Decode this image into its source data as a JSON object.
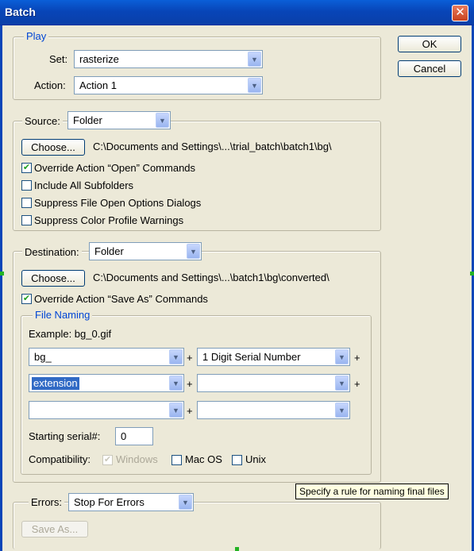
{
  "window": {
    "title": "Batch",
    "close_glyph": "✕"
  },
  "buttons": {
    "ok": "OK",
    "cancel": "Cancel"
  },
  "play": {
    "legend": "Play",
    "set_label": "Set:",
    "set_value": "rasterize",
    "action_label": "Action:",
    "action_value": "Action 1"
  },
  "source": {
    "label": "Source:",
    "value": "Folder",
    "choose_label": "Choose...",
    "path": "C:\\Documents and Settings\\...\\trial_batch\\batch1\\bg\\",
    "options": [
      {
        "label": "Override Action “Open” Commands",
        "checked": true
      },
      {
        "label": "Include All Subfolders",
        "checked": false
      },
      {
        "label": "Suppress File Open Options Dialogs",
        "checked": false
      },
      {
        "label": "Suppress Color Profile Warnings",
        "checked": false
      }
    ]
  },
  "destination": {
    "label": "Destination:",
    "value": "Folder",
    "choose_label": "Choose...",
    "path": "C:\\Documents and Settings\\...\\batch1\\bg\\converted\\",
    "override_label": "Override Action “Save As” Commands",
    "override_checked": true
  },
  "file_naming": {
    "legend": "File Naming",
    "example": "Example: bg_0.gif",
    "fields": [
      [
        "bg_",
        "1 Digit Serial Number"
      ],
      [
        "extension",
        ""
      ],
      [
        "",
        ""
      ]
    ],
    "plus": "+",
    "serial_label": "Starting serial#:",
    "serial_value": "0",
    "compat_label": "Compatibility:",
    "windows": {
      "label": "Windows",
      "checked": true,
      "disabled": true
    },
    "macos": {
      "label": "Mac OS",
      "checked": false
    },
    "unix": {
      "label": "Unix",
      "checked": false
    }
  },
  "tooltip": "Specify a rule for naming final files",
  "errors": {
    "label": "Errors:",
    "value": "Stop For Errors",
    "save_as_label": "Save As..."
  },
  "icons": {
    "dropdown_arrow": "▼",
    "check": "✔"
  }
}
